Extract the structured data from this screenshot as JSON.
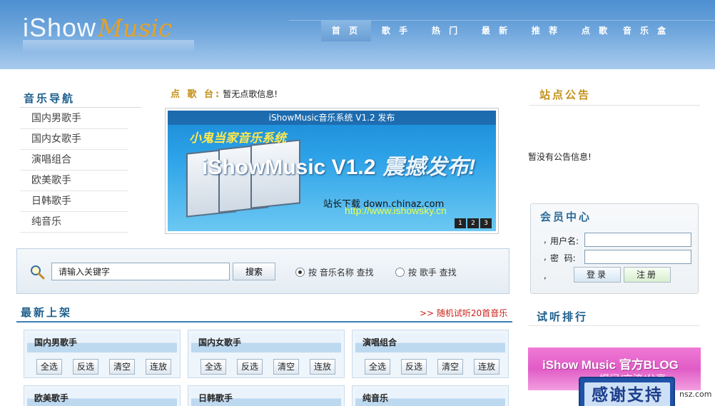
{
  "header": {
    "logo_part1": "iShow",
    "logo_part2": "Music",
    "nav": [
      "首 页",
      "歌 手",
      "热 门",
      "最 新",
      "推 荐",
      "点 歌",
      "音 乐 盒"
    ]
  },
  "left": {
    "title": "音乐导航",
    "items": [
      "国内男歌手",
      "国内女歌手",
      "演唱组合",
      "欧美歌手",
      "日韩歌手",
      "纯音乐"
    ]
  },
  "request": {
    "label": "点 歌 台:",
    "value": "暂无点歌信息!"
  },
  "banner": {
    "caption": "iShowMusic音乐系统 V1.2 发布",
    "subtitle": "小鬼当家音乐系统",
    "main": "iShowMusic V1.2",
    "main_zh": "震撼发布!",
    "watermark": "站长下载 down.chinaz.com",
    "url": "http://www.ishowsky.cn",
    "pages": [
      "1",
      "2",
      "3"
    ]
  },
  "search": {
    "value": "请输入关键字",
    "button": "搜索",
    "opt1": "按 音乐名称 查找",
    "opt2": "按 歌手 查找"
  },
  "newest": {
    "title": "最新上架",
    "random_link": ">> 随机试听20首音乐",
    "buttons": [
      "全选",
      "反选",
      "清空",
      "连放"
    ],
    "categories": [
      "国内男歌手",
      "国内女歌手",
      "演唱组合",
      "欧美歌手",
      "日韩歌手",
      "纯音乐"
    ]
  },
  "notice": {
    "title": "站点公告",
    "text": "暂没有公告信息!"
  },
  "member": {
    "title": "会员中心",
    "username_label": "用户名:",
    "password_label": "密  码:",
    "login": "登录",
    "register": "注册"
  },
  "rank": {
    "title": "试听排行"
  },
  "blog": {
    "text": "iShow Music 官方BLOG",
    "sub": "提问/交流/分享"
  },
  "thanks": {
    "text": "感谢支持"
  },
  "corner": "nsz.com"
}
